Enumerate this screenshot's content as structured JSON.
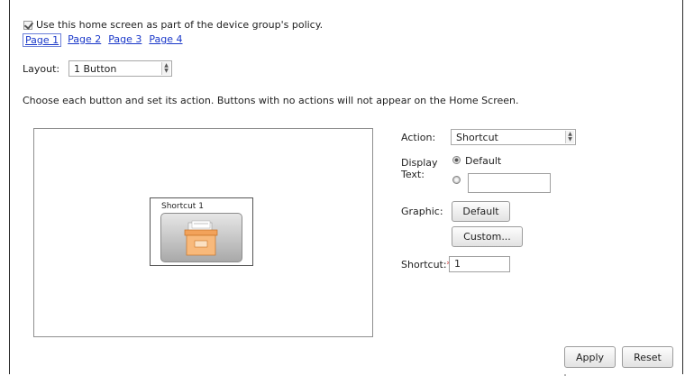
{
  "policy": {
    "checked": true,
    "label": "Use this home screen as part of the device group's policy."
  },
  "pages": [
    {
      "label": "Page 1",
      "active": true
    },
    {
      "label": "Page 2",
      "active": false
    },
    {
      "label": "Page 3",
      "active": false
    },
    {
      "label": "Page 4",
      "active": false
    }
  ],
  "layout": {
    "label": "Layout:",
    "value": "1 Button"
  },
  "instructions": "Choose each button and set its action. Buttons with no actions will not appear on the Home Screen.",
  "preview": {
    "shortcut_title": "Shortcut 1",
    "shortcut_icon": "folder-shortcut-icon"
  },
  "form": {
    "action_label": "Action:",
    "action_value": "Shortcut",
    "display_text_label": "Display Text:",
    "display_default_label": "Default",
    "display_custom_value": "",
    "graphic_label": "Graphic:",
    "graphic_default_button": "Default",
    "graphic_custom_button": "Custom...",
    "shortcut_label": "Shortcut:",
    "shortcut_required": "*",
    "shortcut_value": "1"
  },
  "footer": {
    "apply_label": "Apply",
    "reset_label": "Reset"
  }
}
